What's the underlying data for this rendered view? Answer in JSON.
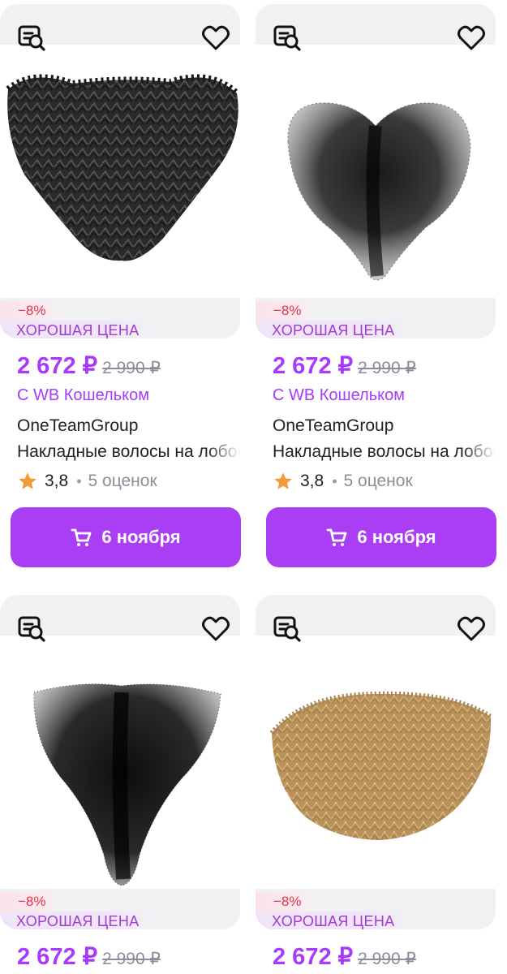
{
  "colors": {
    "accent": "#a73afd",
    "button_bg": "#a93ef4",
    "discount_text": "#e2334f",
    "goodprice_text": "#a23bd0",
    "star": "#f29a3d"
  },
  "products": [
    {
      "discount": "−8%",
      "badge": "ХОРОШАЯ ЦЕНА",
      "price": "2 672 ₽",
      "old_price": "2 990 ₽",
      "wallet": "С WB Кошельком",
      "brand": "OneTeamGroup",
      "name": "Накладные волосы на лобок",
      "rating": "3,8",
      "dot": "•",
      "reviews": "5 оценок",
      "delivery": "6 ноября"
    },
    {
      "discount": "−8%",
      "badge": "ХОРОШАЯ ЦЕНА",
      "price": "2 672 ₽",
      "old_price": "2 990 ₽",
      "wallet": "С WB Кошельком",
      "brand": "OneTeamGroup",
      "name": "Накладные волосы на лобок",
      "rating": "3,8",
      "dot": "•",
      "reviews": "5 оценок",
      "delivery": "6 ноября"
    },
    {
      "discount": "−8%",
      "badge": "ХОРОШАЯ ЦЕНА",
      "price": "2 672 ₽",
      "old_price": "2 990 ₽"
    },
    {
      "discount": "−8%",
      "badge": "ХОРОШАЯ ЦЕНА",
      "price": "2 672 ₽",
      "old_price": "2 990 ₽"
    }
  ],
  "icons": {
    "similar": "image-search-icon",
    "favorite": "heart-icon",
    "star": "star-icon",
    "cart": "cart-icon"
  }
}
